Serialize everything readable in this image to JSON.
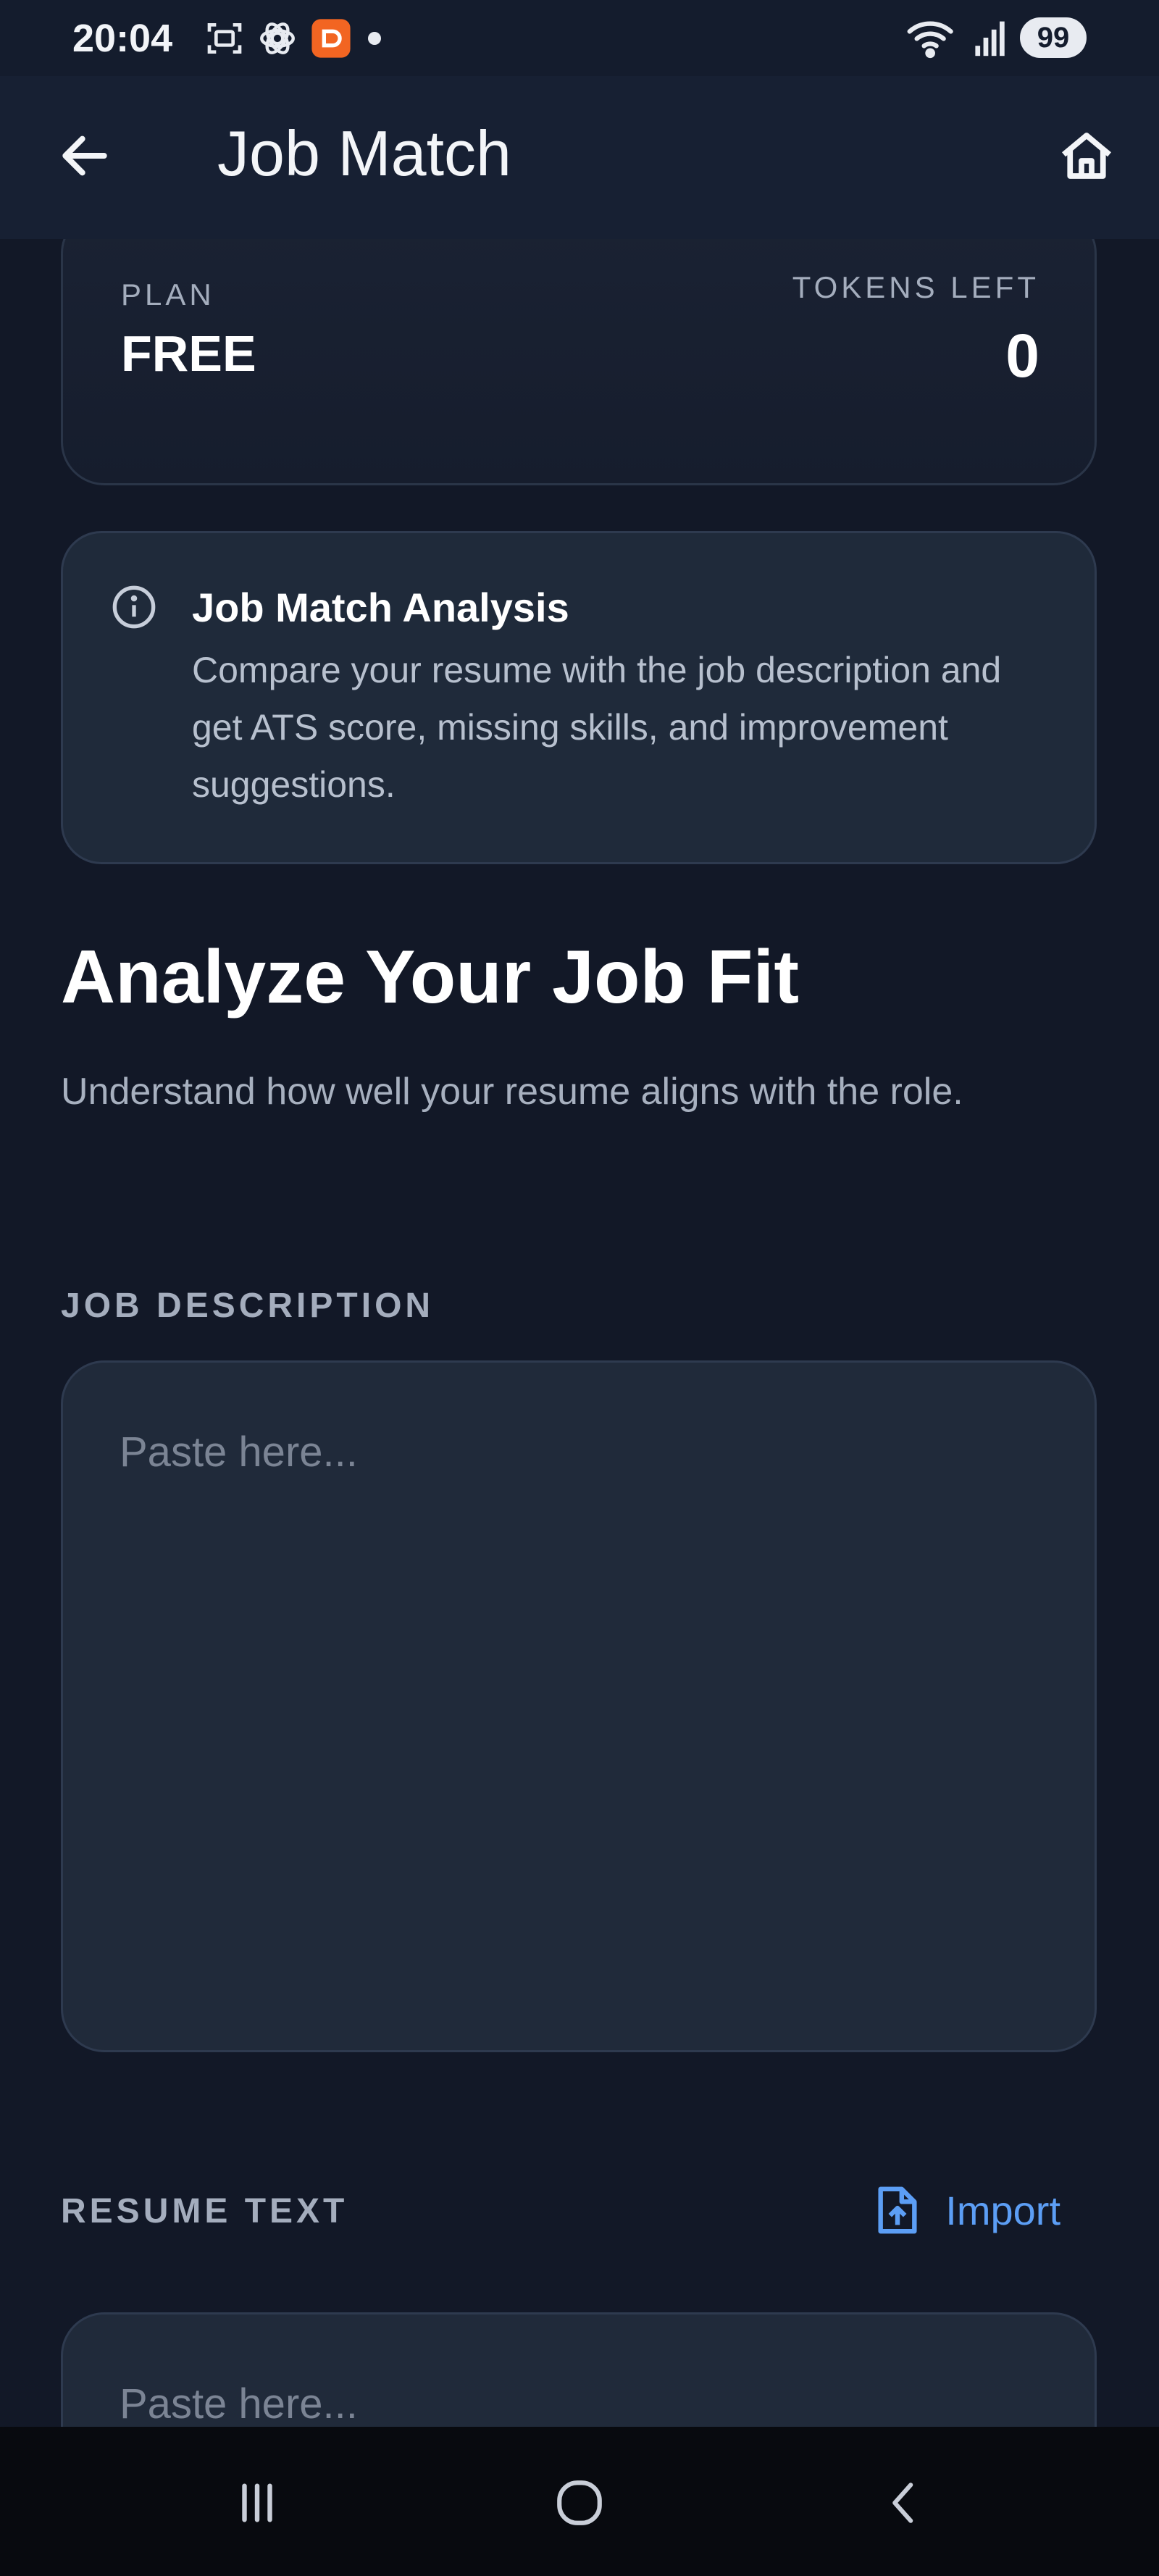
{
  "status_bar": {
    "time": "20:04",
    "battery": "99",
    "icons": [
      "screenshot-icon",
      "chatgpt-icon",
      "app-notification-icon",
      "dot-icon",
      "wifi-icon",
      "signal-icon"
    ]
  },
  "app_bar": {
    "title": "Job Match",
    "icons": [
      "back-arrow-icon",
      "home-icon"
    ]
  },
  "plan_card": {
    "plan_label": "PLAN",
    "plan_value": "FREE",
    "tokens_label": "TOKENS LEFT",
    "tokens_value": "0"
  },
  "info_card": {
    "title": "Job Match Analysis",
    "description": "Compare your resume with the job description and get ATS score, missing skills, and improvement suggestions."
  },
  "main": {
    "heading": "Analyze Your Job Fit",
    "subheading": "Understand how well your resume aligns with the role."
  },
  "job_description": {
    "label": "JOB DESCRIPTION",
    "value": "",
    "placeholder": "Paste here..."
  },
  "resume": {
    "label": "RESUME TEXT",
    "import_label": "Import",
    "value": "",
    "placeholder": "Paste here..."
  },
  "colors": {
    "background": "#121827",
    "card": "#1f2a3a",
    "accent": "#5c9ef5"
  }
}
